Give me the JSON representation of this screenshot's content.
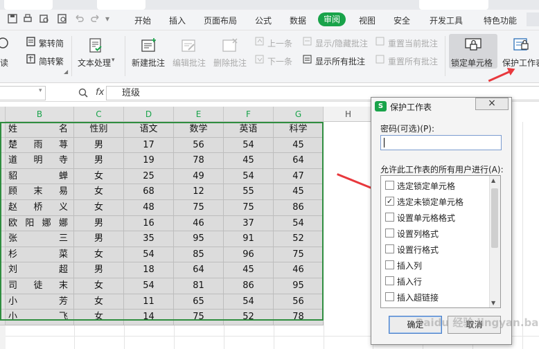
{
  "quick_access": {
    "icons": [
      "save-icon",
      "print-icon",
      "print-preview-icon",
      "undo-icon",
      "redo-icon"
    ]
  },
  "menu": {
    "items": [
      "开始",
      "插入",
      "页面布局",
      "公式",
      "数据",
      "审阅",
      "视图",
      "安全",
      "开发工具",
      "特色功能"
    ],
    "active": "审阅",
    "accent": "#19a34a"
  },
  "ribbon": {
    "read_partial": "读",
    "trad_to_simp": "繁转简",
    "simp_to_trad": "简转繁",
    "text_process": "文本处理",
    "new_comment": "新建批注",
    "edit_comment": "编辑批注",
    "delete_comment": "删除批注",
    "prev": "上一条",
    "next": "下一条",
    "show_hide_comment": "显示/隐藏批注",
    "show_all_comments": "显示所有批注",
    "reset_current_comment": "重置当前批注",
    "reset_all_comments": "重置所有批注",
    "lock_cell": "锁定单元格",
    "protect_sheet": "保护工作表"
  },
  "formula_bar": {
    "fx": "fx",
    "value": "班级"
  },
  "columns": [
    "B",
    "C",
    "D",
    "E",
    "F",
    "G",
    "H"
  ],
  "table": {
    "headers": [
      "姓名",
      "性别",
      "语文",
      "数学",
      "英语",
      "科学"
    ],
    "rows": [
      [
        "楚雨荨",
        "男",
        "17",
        "56",
        "54",
        "45"
      ],
      [
        "道明寺",
        "男",
        "19",
        "78",
        "45",
        "64"
      ],
      [
        "貂蝉",
        "女",
        "25",
        "49",
        "54",
        "47"
      ],
      [
        "顾末易",
        "女",
        "68",
        "12",
        "55",
        "45"
      ],
      [
        "赵桥义",
        "女",
        "48",
        "75",
        "75",
        "86"
      ],
      [
        "欧阳娜娜",
        "男",
        "16",
        "46",
        "37",
        "54"
      ],
      [
        "张三",
        "男",
        "35",
        "95",
        "91",
        "52"
      ],
      [
        "杉菜",
        "女",
        "54",
        "85",
        "96",
        "75"
      ],
      [
        "刘超",
        "男",
        "18",
        "64",
        "45",
        "46"
      ],
      [
        "司徒末",
        "女",
        "54",
        "81",
        "86",
        "95"
      ],
      [
        "小芳",
        "女",
        "11",
        "65",
        "54",
        "56"
      ],
      [
        "小飞",
        "女",
        "14",
        "75",
        "52",
        "78"
      ]
    ]
  },
  "dialog": {
    "title": "保护工作表",
    "close": "×",
    "password_label": "密码(可选)(P):",
    "password_value": "",
    "allow_label": "允许此工作表的所有用户进行(A):",
    "options": [
      {
        "label": "选定锁定单元格",
        "checked": false
      },
      {
        "label": "选定未锁定单元格",
        "checked": true
      },
      {
        "label": "设置单元格格式",
        "checked": false
      },
      {
        "label": "设置列格式",
        "checked": false
      },
      {
        "label": "设置行格式",
        "checked": false
      },
      {
        "label": "插入列",
        "checked": false
      },
      {
        "label": "插入行",
        "checked": false
      },
      {
        "label": "插入超链接",
        "checked": false
      }
    ],
    "ok": "确定",
    "cancel": "取消",
    "check_mark": "✓"
  },
  "watermark": "Baidu 经验 jingyan.baidu.com"
}
